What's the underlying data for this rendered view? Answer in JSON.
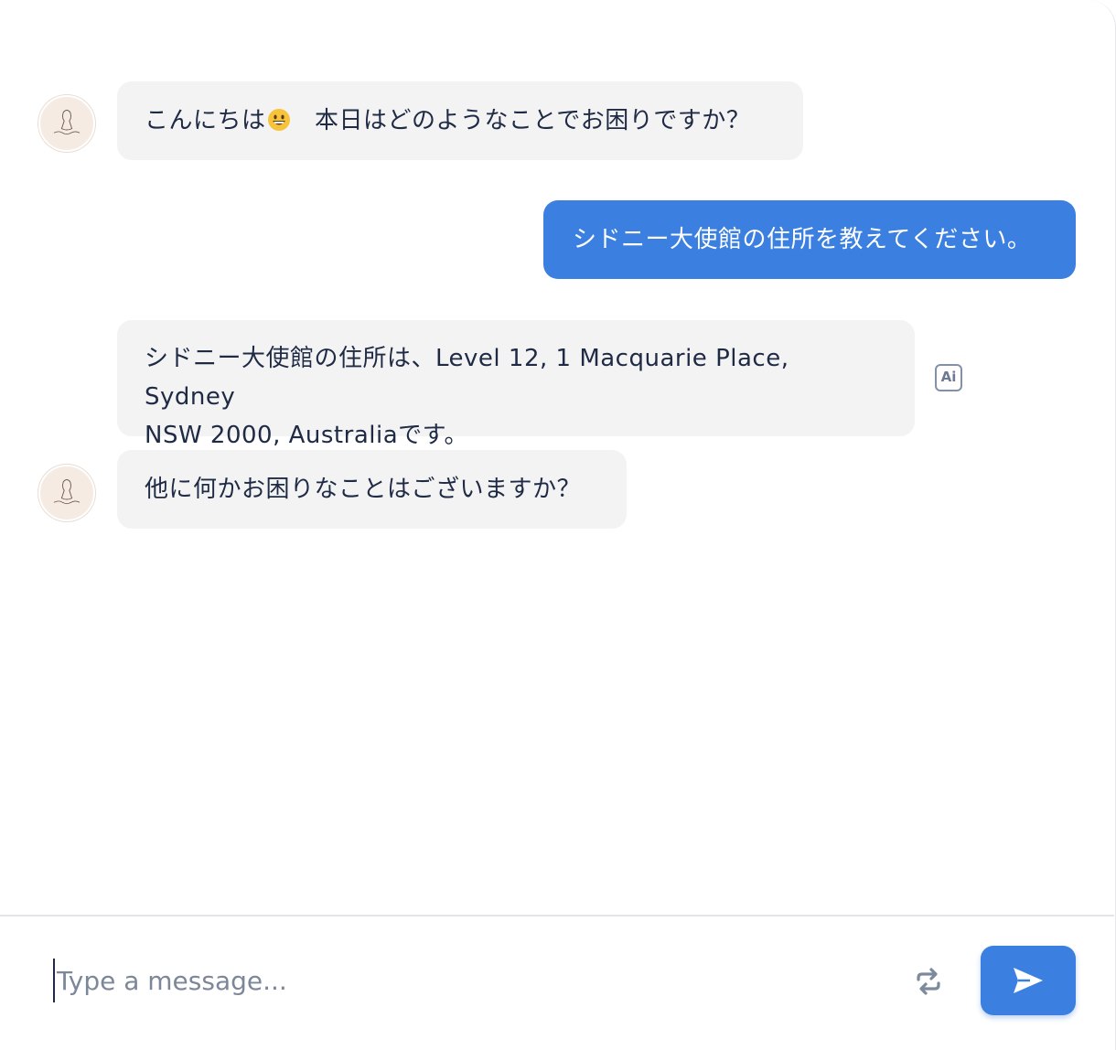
{
  "conversation": {
    "messages": [
      {
        "role": "bot",
        "text_before_emoji": "こんにちは",
        "emoji": "grinning-face-emoji",
        "text_after_emoji": "　本日はどのようなことでお困りですか？"
      },
      {
        "role": "user",
        "text": "シドニー大使館の住所を教えてください。"
      },
      {
        "role": "bot",
        "line1": "シドニー大使館の住所は、Level 12, 1 Macquarie Place, Sydney",
        "line2": "NSW 2000, Australiaです。",
        "badge": "Ai"
      },
      {
        "role": "bot",
        "text": "他に何かお困りなことはございますか？"
      }
    ]
  },
  "composer": {
    "placeholder": "Type a message...",
    "refresh_icon": "refresh-icon",
    "send_icon": "send-icon"
  },
  "colors": {
    "accent": "#3b7fe0",
    "bot_bubble": "#f3f3f4",
    "text": "#1f2a44"
  }
}
